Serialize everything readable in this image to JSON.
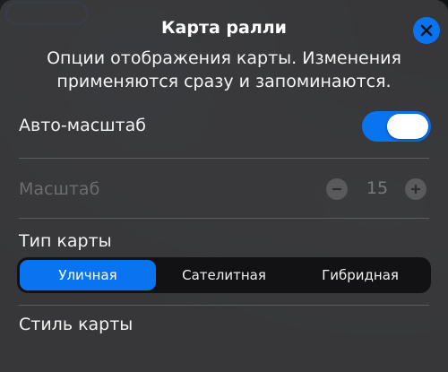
{
  "colors": {
    "accent": "#0a74f0",
    "sheet": "#3c3c3f",
    "segmented_bg": "#121214"
  },
  "sheet": {
    "title": "Карта ралли",
    "subtitle": "Опции отображения карты. Изменения применяются сразу и запоминаются.",
    "close_icon": "close-icon"
  },
  "auto_scale": {
    "label": "Авто-масштаб",
    "enabled": true
  },
  "scale": {
    "label": "Масштаб",
    "value": "15",
    "disabled": true,
    "minus_icon": "minus-icon",
    "plus_icon": "plus-icon"
  },
  "map_type": {
    "label": "Тип карты",
    "options": [
      "Уличная",
      "Сателитная",
      "Гибридная"
    ],
    "selected": "Уличная"
  },
  "map_style": {
    "label": "Стиль карты"
  }
}
